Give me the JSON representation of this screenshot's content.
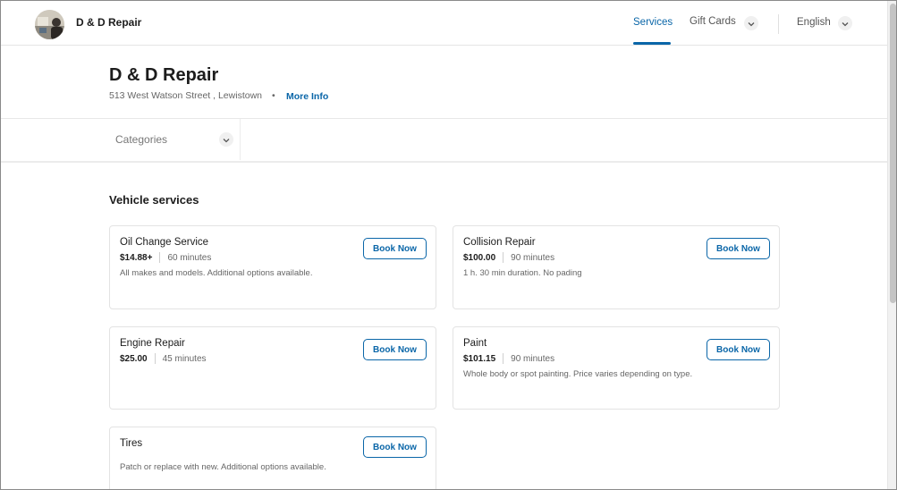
{
  "nav": {
    "brand": "D & D Repair",
    "services": "Services",
    "gift_cards": "Gift Cards",
    "language": "English"
  },
  "header": {
    "title": "D & D Repair",
    "address": "513 West Watson Street , Lewistown",
    "separator": "•",
    "more_info": "More Info"
  },
  "filter": {
    "categories": "Categories"
  },
  "section": {
    "title": "Vehicle services"
  },
  "services": [
    {
      "name": "Oil Change Service",
      "price": "$14.88+",
      "duration": "60 minutes",
      "description": "All makes and models. Additional options available.",
      "button": "Book Now"
    },
    {
      "name": "Collision Repair",
      "price": "$100.00",
      "duration": "90 minutes",
      "description": "1 h. 30 min duration. No pading",
      "button": "Book Now"
    },
    {
      "name": "Engine Repair",
      "price": "$25.00",
      "duration": "45 minutes",
      "description": "",
      "button": "Book Now"
    },
    {
      "name": "Paint",
      "price": "$101.15",
      "duration": "90 minutes",
      "description": "Whole body or spot painting. Price varies depending on type.",
      "button": "Book Now"
    },
    {
      "name": "Tires",
      "price": "",
      "duration": "",
      "description": "Patch or replace with new. Additional options available.",
      "button": "Book Now"
    }
  ],
  "colors": {
    "accent": "#0a66a8",
    "text": "#1c1c1c",
    "muted": "#666666",
    "border": "#e3e3e3"
  },
  "icons": {
    "logo": "business-avatar-icon",
    "dropdown": "chevron-down-icon"
  }
}
